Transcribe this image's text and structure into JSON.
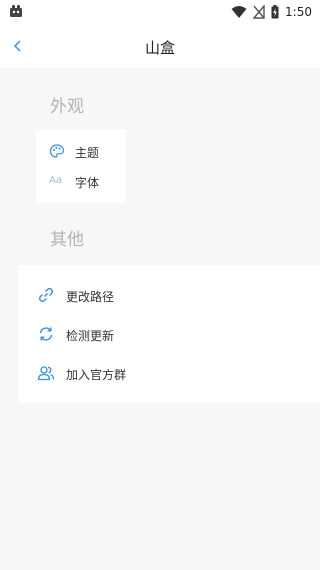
{
  "status_bar": {
    "time": "1:50"
  },
  "header": {
    "title": "山盒"
  },
  "sections": [
    {
      "title": "外观",
      "items": [
        {
          "label": "主题",
          "icon": "palette-icon"
        },
        {
          "label": "字体",
          "icon": "font-aa-icon",
          "icon_text": "Aa"
        }
      ]
    },
    {
      "title": "其他",
      "items": [
        {
          "label": "更改路径",
          "icon": "link-icon"
        },
        {
          "label": "检测更新",
          "icon": "refresh-icon"
        },
        {
          "label": "加入官方群",
          "icon": "group-icon"
        }
      ]
    }
  ],
  "colors": {
    "accent": "#3d8fe0",
    "section_title": "#b3b3b3",
    "background": "#f7f7f7"
  }
}
